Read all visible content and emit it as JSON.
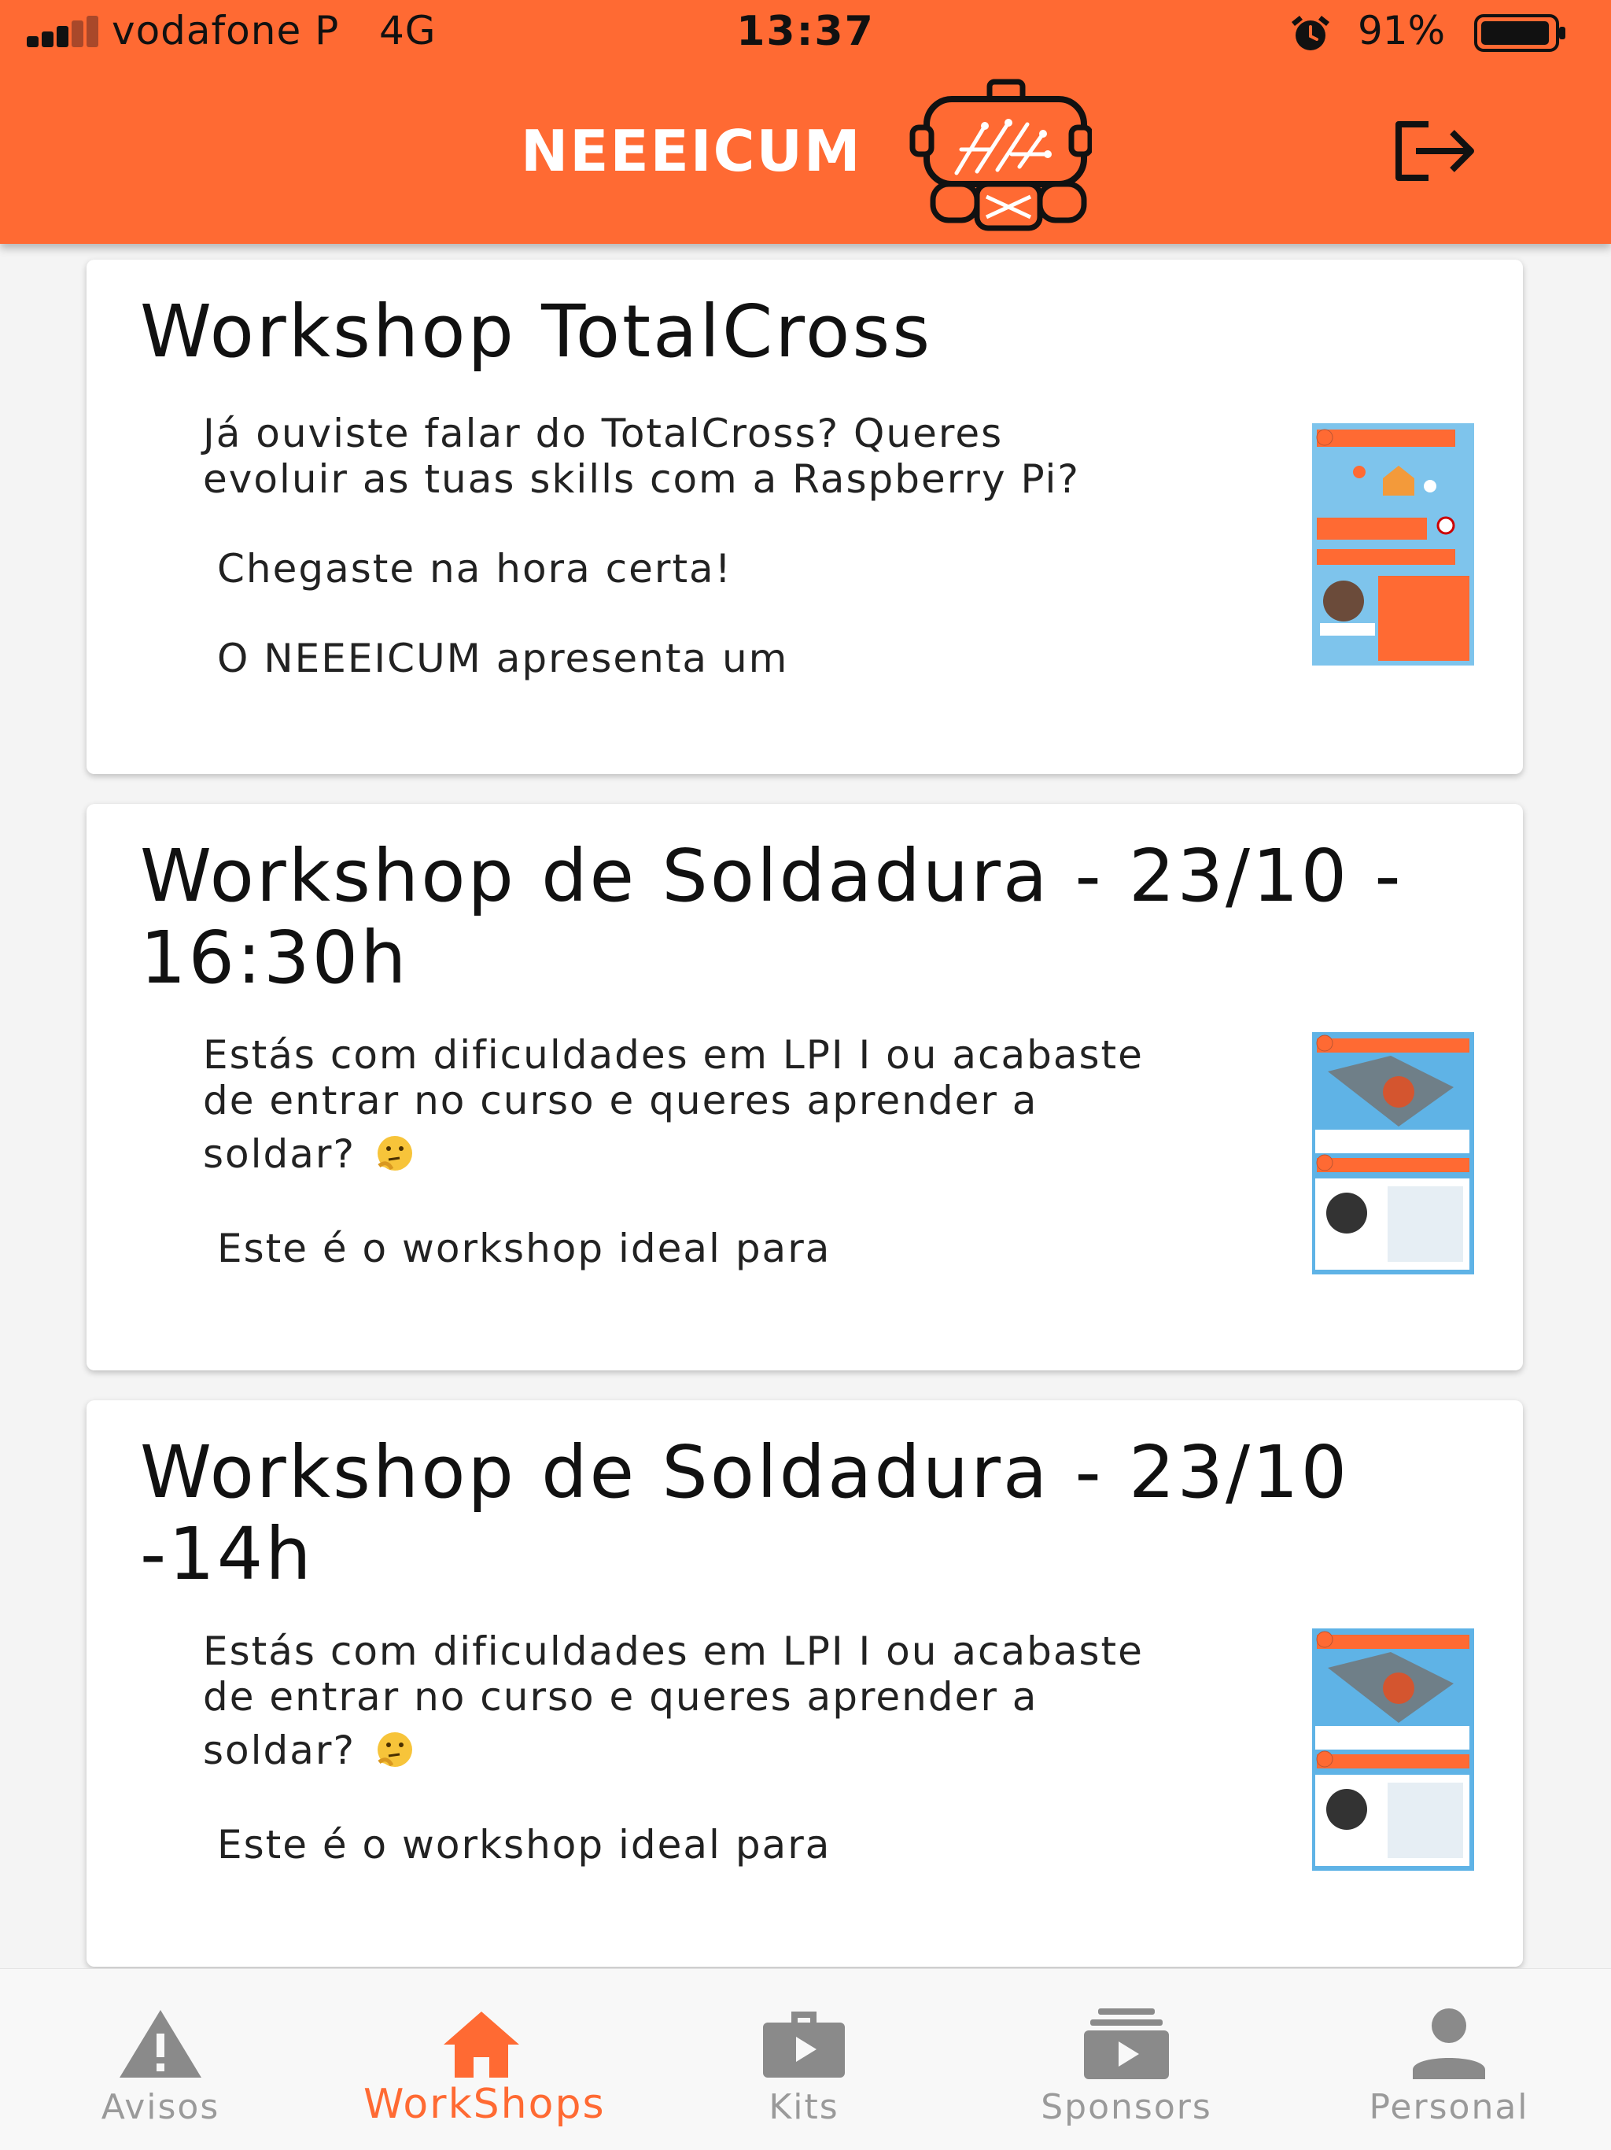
{
  "status_bar": {
    "carrier": "vodafone P",
    "network": "4G",
    "time": "13:37",
    "battery": "91%"
  },
  "header": {
    "title": "NEEEICUM",
    "logo_icon": "robot-circuit-logo",
    "logout_icon": "logout-icon",
    "background": "#ff6a33"
  },
  "workshops": [
    {
      "title": "Workshop TotalCross",
      "lines": [
        "Já ouviste falar do TotalCross? Queres",
        "evoluir as tuas skills com a Raspberry Pi?"
      ],
      "para2": "Chegaste na hora certa!",
      "para3": "O NEEEICUM apresenta um"
    },
    {
      "title": "Workshop de Soldadura - 23/10 - 16:30h",
      "lines": [
        "Estás com dificuldades em LPI I ou acabaste",
        "de entrar no curso e queres aprender a",
        "soldar?"
      ],
      "para2": "Este é o workshop ideal para"
    },
    {
      "title": "Workshop de Soldadura - 23/10 -14h",
      "lines": [
        "Estás com dificuldades em LPI I ou acabaste",
        "de entrar no curso e queres aprender a",
        "soldar?"
      ],
      "para2": "Este é o workshop ideal para"
    }
  ],
  "bottom_nav": {
    "items": [
      {
        "label": "Avisos",
        "icon": "warning-icon"
      },
      {
        "label": "WorkShops",
        "icon": "home-icon"
      },
      {
        "label": "Kits",
        "icon": "briefcase-play-icon"
      },
      {
        "label": "Sponsors",
        "icon": "subscriptions-icon"
      },
      {
        "label": "Personal",
        "icon": "person-icon"
      }
    ],
    "active": "WorkShops",
    "active_color": "#ff6a33",
    "inactive_color": "#9a9a9a"
  }
}
